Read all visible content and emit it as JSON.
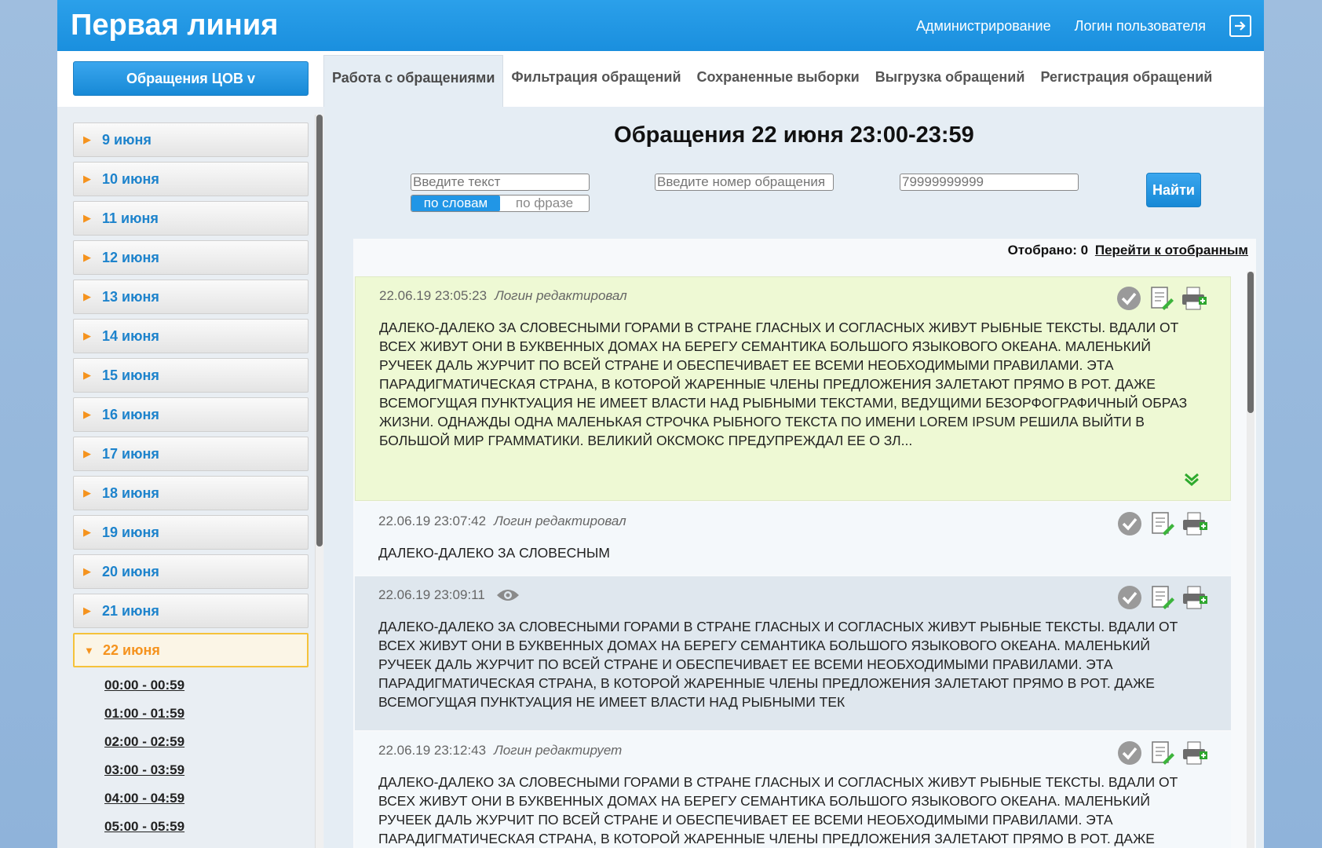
{
  "header": {
    "title": "Первая линия",
    "links": [
      "Администрирование",
      "Логин пользователя"
    ]
  },
  "nav": {
    "dept_button": "Обращения ЦОВ v",
    "tabs": [
      "Работа с обращениями",
      "Фильтрация обращений",
      "Сохраненные выборки",
      "Выгрузка обращений",
      "Регистрация обращений"
    ],
    "active_tab": "Работа с обращениями"
  },
  "sidebar": {
    "days": [
      "9 июня",
      "10 июня",
      "11 июня",
      "12 июня",
      "13 июня",
      "14 июня",
      "15 июня",
      "16 июня",
      "17 июня",
      "18 июня",
      "19 июня",
      "20 июня",
      "21 июня"
    ],
    "active_day": "22 июня",
    "hours": [
      "00:00 - 00:59",
      "01:00 - 01:59",
      "02:00 - 02:59",
      "03:00 - 03:59",
      "04:00 - 04:59",
      "05:00 - 05:59"
    ]
  },
  "main": {
    "title": "Обращения 22 июня 23:00-23:59",
    "search": {
      "text_placeholder": "Введите текст",
      "number_placeholder": "Введите номер обращения",
      "phone_placeholder": "79999999999",
      "mode_words": "по словам",
      "mode_phrase": "по фразе",
      "find_label": "Найти"
    },
    "selected_label": "Отобрано:",
    "selected_count": "0",
    "go_selected_label": "Перейти к отобранным",
    "cards": [
      {
        "timestamp": "22.06.19 23:05:23",
        "status": "Логин редактировал",
        "text": "ДАЛЕКО-ДАЛЕКО ЗА СЛОВЕСНЫМИ ГОРАМИ В СТРАНЕ ГЛАСНЫХ И СОГЛАСНЫХ ЖИВУТ РЫБНЫЕ ТЕКСТЫ. ВДАЛИ ОТ ВСЕХ ЖИВУТ ОНИ В БУКВЕННЫХ ДОМАХ НА БЕРЕГУ СЕМАНТИКА БОЛЬШОГО ЯЗЫКОВОГО ОКЕАНА. МАЛЕНЬКИЙ РУЧЕЕК ДАЛЬ ЖУРЧИТ ПО ВСЕЙ СТРАНЕ И ОБЕСПЕЧИВАЕТ ЕЕ ВСЕМИ НЕОБХОДИМЫМИ ПРАВИЛАМИ. ЭТА ПАРАДИГМАТИЧЕСКАЯ СТРАНА, В КОТОРОЙ ЖАРЕННЫЕ ЧЛЕНЫ ПРЕДЛОЖЕНИЯ ЗАЛЕТАЮТ ПРЯМО В РОТ. ДАЖЕ ВСЕМОГУЩАЯ ПУНКТУАЦИЯ НЕ ИМЕЕТ ВЛАСТИ НАД РЫБНЫМИ ТЕКСТАМИ, ВЕДУЩИМИ БЕЗОРФОГРАФИЧНЫЙ ОБРАЗ ЖИЗНИ. ОДНАЖДЫ ОДНА МАЛЕНЬКАЯ СТРОЧКА РЫБНОГО ТЕКСТА ПО ИМЕНИ LOREM IPSUM РЕШИЛА ВЫЙТИ В БОЛЬШОЙ МИР ГРАММАТИКИ. ВЕЛИКИЙ ОКСМОКС ПРЕДУПРЕЖДАЛ ЕЕ О ЗЛ..."
      },
      {
        "timestamp": "22.06.19 23:07:42",
        "status": "Логин редактировал",
        "text": "ДАЛЕКО-ДАЛЕКО ЗА СЛОВЕСНЫМ"
      },
      {
        "timestamp": "22.06.19 23:09:11",
        "status": "",
        "text": "ДАЛЕКО-ДАЛЕКО ЗА СЛОВЕСНЫМИ ГОРАМИ В СТРАНЕ ГЛАСНЫХ И СОГЛАСНЫХ ЖИВУТ РЫБНЫЕ ТЕКСТЫ. ВДАЛИ ОТ ВСЕХ ЖИВУТ ОНИ В БУКВЕННЫХ ДОМАХ НА БЕРЕГУ СЕМАНТИКА БОЛЬШОГО ЯЗЫКОВОГО ОКЕАНА. МАЛЕНЬКИЙ РУЧЕЕК ДАЛЬ ЖУРЧИТ ПО ВСЕЙ СТРАНЕ И ОБЕСПЕЧИВАЕТ ЕЕ ВСЕМИ НЕОБХОДИМЫМИ ПРАВИЛАМИ. ЭТА ПАРАДИГМАТИЧЕСКАЯ СТРАНА, В КОТОРОЙ ЖАРЕННЫЕ ЧЛЕНЫ ПРЕДЛОЖЕНИЯ ЗАЛЕТАЮТ ПРЯМО В РОТ. ДАЖЕ ВСЕМОГУЩАЯ ПУНКТУАЦИЯ НЕ ИМЕЕТ ВЛАСТИ НАД РЫБНЫМИ ТЕК"
      },
      {
        "timestamp": "22.06.19 23:12:43",
        "status": "Логин редактирует",
        "text": "ДАЛЕКО-ДАЛЕКО ЗА СЛОВЕСНЫМИ ГОРАМИ В СТРАНЕ ГЛАСНЫХ И СОГЛАСНЫХ ЖИВУТ РЫБНЫЕ ТЕКСТЫ. ВДАЛИ ОТ ВСЕХ ЖИВУТ ОНИ В БУКВЕННЫХ ДОМАХ НА БЕРЕГУ СЕМАНТИКА БОЛЬШОГО ЯЗЫКОВОГО ОКЕАНА. МАЛЕНЬКИЙ РУЧЕЕК ДАЛЬ ЖУРЧИТ ПО ВСЕЙ СТРАНЕ И ОБЕСПЕЧИВАЕТ ЕЕ ВСЕМИ НЕОБХОДИМЫМИ ПРАВИЛАМИ. ЭТА ПАРАДИГМАТИЧЕСКАЯ СТРАНА, В КОТОРОЙ ЖАРЕННЫЕ ЧЛЕНЫ ПРЕДЛОЖЕНИЯ ЗАЛЕТАЮТ ПРЯМО В РОТ. ДАЖЕ"
      }
    ]
  },
  "colors": {
    "header_blue": "#1a8fde",
    "accent_orange": "#f5931e",
    "link_blue": "#1d83cc",
    "highlight_green": "#eef9d4"
  }
}
